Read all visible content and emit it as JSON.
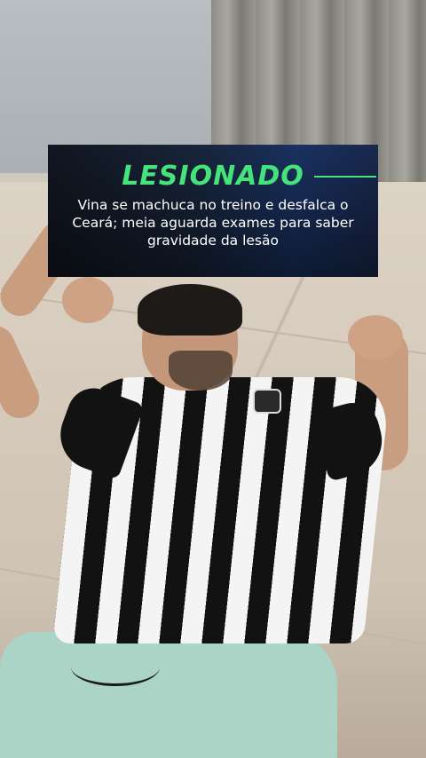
{
  "overlay": {
    "headline": "LESIONADO",
    "subtitle": "Vina se machuca no treino e desfalca o Ceará; meia aguarda exames para saber gravidade da lesão",
    "headline_color": "#45e37a"
  },
  "photo": {
    "jersey_colors": [
      "#f4f4f4",
      "#121212"
    ],
    "shorts_color": "#a9d4c6"
  }
}
